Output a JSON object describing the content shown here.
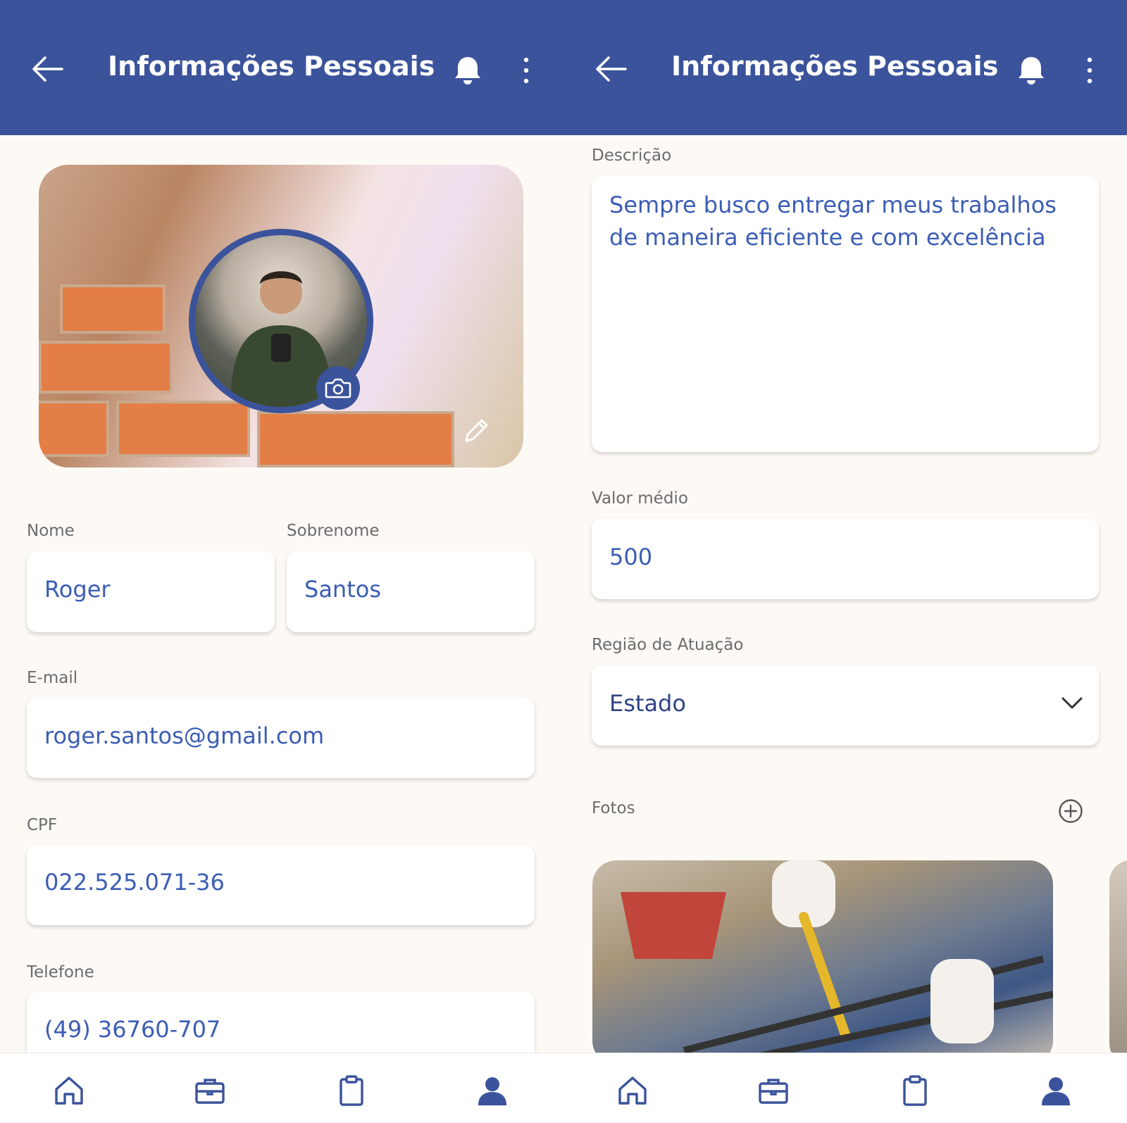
{
  "colors": {
    "primary": "#3b539b",
    "field_value": "#3b5db4",
    "label": "#6b6b6b",
    "background": "#fdfaf6"
  },
  "left_screen": {
    "appbar": {
      "title": "Informações Pessoais",
      "icons": [
        "arrow-left-icon",
        "bell-icon",
        "more-vertical-icon"
      ]
    },
    "profile": {
      "cover_icon": "pencil-icon",
      "avatar_button_icon": "camera-icon"
    },
    "fields": {
      "nome": {
        "label": "Nome",
        "value": "Roger"
      },
      "sobrenome": {
        "label": "Sobrenome",
        "value": "Santos"
      },
      "email": {
        "label": "E-mail",
        "value": "roger.santos@gmail.com"
      },
      "cpf": {
        "label": "CPF",
        "value": "022.525.071-36"
      },
      "telefone": {
        "label": "Telefone",
        "value": "(49) 36760-707"
      }
    }
  },
  "right_screen": {
    "appbar": {
      "title": "Informações Pessoais",
      "icons": [
        "arrow-left-icon",
        "bell-icon",
        "more-vertical-icon"
      ]
    },
    "fields": {
      "descricao": {
        "label": "Descrição",
        "value": "Sempre busco entregar meus trabalhos de maneira eficiente e com excelência"
      },
      "valor_medio": {
        "label": "Valor médio",
        "value": "500"
      },
      "regiao": {
        "label": "Região de Atuação",
        "value": "Estado"
      }
    },
    "fotos": {
      "label": "Fotos",
      "add_icon": "plus-circle-icon"
    }
  },
  "bottom_nav": {
    "items": [
      "home-icon",
      "briefcase-icon",
      "clipboard-icon",
      "user-icon"
    ],
    "active": "user-icon"
  }
}
